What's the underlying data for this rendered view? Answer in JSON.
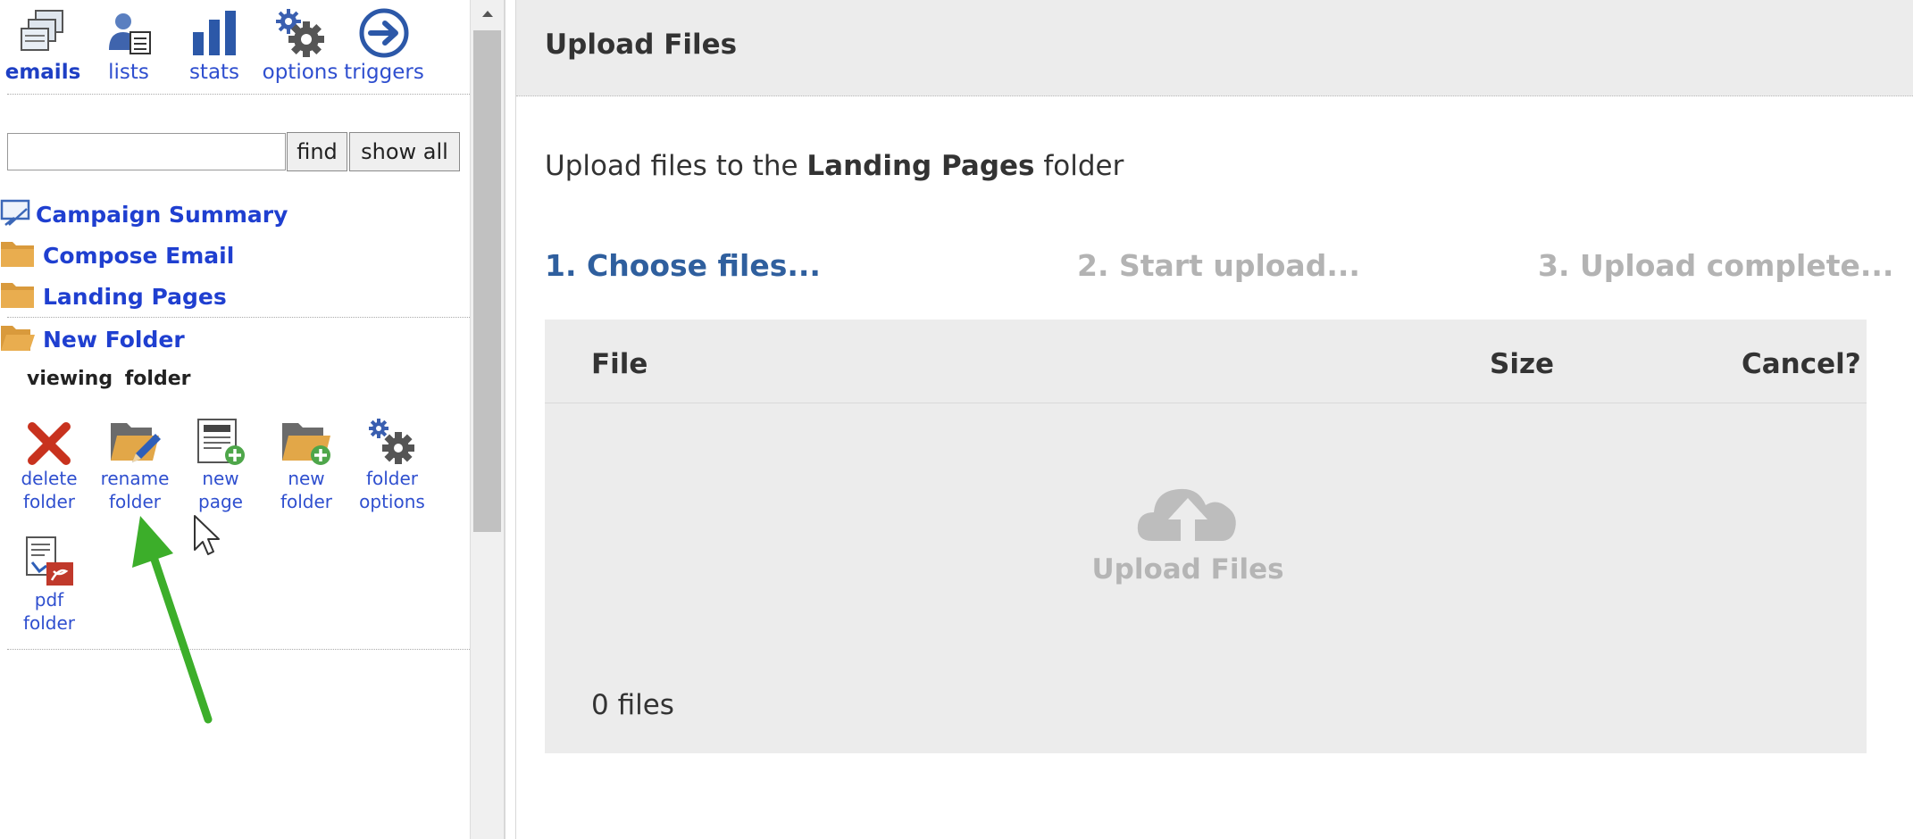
{
  "nav": {
    "items": [
      {
        "label": "emails",
        "icon": "emails-icon"
      },
      {
        "label": "lists",
        "icon": "lists-icon"
      },
      {
        "label": "stats",
        "icon": "stats-icon"
      },
      {
        "label": "options",
        "icon": "gear-icon"
      },
      {
        "label": "triggers",
        "icon": "arrow-circle-icon"
      }
    ]
  },
  "search": {
    "value": "",
    "placeholder": "",
    "find_label": "find",
    "show_all_label": "show all"
  },
  "tree": [
    {
      "label": "Campaign Summary",
      "icon": "campaign-summary-icon"
    },
    {
      "label": "Compose Email",
      "icon": "folder-icon"
    },
    {
      "label": "Landing Pages",
      "icon": "folder-icon"
    },
    {
      "label": "New Folder",
      "icon": "folder-icon"
    }
  ],
  "viewing_label": "viewing folder",
  "actions": [
    {
      "line1": "delete",
      "line2": "folder",
      "icon": "delete-icon"
    },
    {
      "line1": "rename",
      "line2": "folder",
      "icon": "rename-folder-icon"
    },
    {
      "line1": "new",
      "line2": "page",
      "icon": "new-page-icon"
    },
    {
      "line1": "new",
      "line2": "folder",
      "icon": "new-folder-icon"
    },
    {
      "line1": "folder",
      "line2": "options",
      "icon": "folder-options-icon"
    },
    {
      "line1": "pdf",
      "line2": "folder",
      "icon": "pdf-folder-icon"
    }
  ],
  "main": {
    "title": "Upload Files",
    "instruction_prefix": "Upload files to the ",
    "instruction_folder": "Landing Pages",
    "instruction_suffix": " folder",
    "steps": [
      "1. Choose files...",
      "2. Start upload...",
      "3. Upload complete..."
    ],
    "columns": {
      "file": "File",
      "size": "Size",
      "cancel": "Cancel?"
    },
    "dropzone_label": "Upload Files",
    "file_count": "0 files"
  },
  "colors": {
    "link": "#1f3fd0",
    "step_active": "#2f5f9e",
    "step_inactive": "#b3b3b3",
    "arrow": "#3cae2a"
  }
}
